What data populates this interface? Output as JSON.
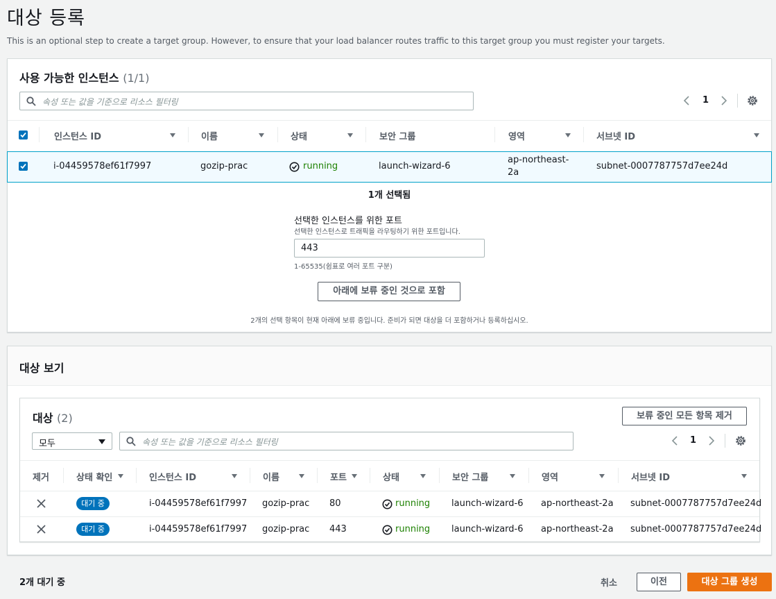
{
  "page": {
    "title": "대상 등록",
    "description": "This is an optional step to create a target group. However, to ensure that your load balancer routes traffic to this target group you must register your targets."
  },
  "available": {
    "title": "사용 가능한 인스턴스",
    "count": "(1/1)",
    "search_placeholder": "속성 또는 값을 기준으로 리소스 필터링",
    "page": "1",
    "columns": [
      "인스턴스 ID",
      "이름",
      "상태",
      "보안 그룹",
      "영역",
      "서브넷 ID"
    ],
    "row": {
      "instance_id": "i-04459578ef61f7997",
      "name": "gozip-prac",
      "state": "running",
      "security_group": "launch-wizard-6",
      "zone_line1": "ap-northeast-",
      "zone_line2": "2a",
      "subnet": "subnet-0007787757d7ee24d"
    },
    "selected_text": "1개 선택됨",
    "port_label": "선택한 인스턴스를 위한 포트",
    "port_desc": "선택한 인스턴스로 트래픽을 라우팅하기 위한 포트입니다.",
    "port_value": "443",
    "port_hint": "1-65535(쉼표로 여러 포트 구분)",
    "include_button": "아래에 보류 중인 것으로 포함",
    "pending_note": "2개의 선택 항목이 현재 아래에 보류 중입니다. 준비가 되면 대상을 더 포함하거나 등록하십시오."
  },
  "review": {
    "title": "대상 보기",
    "targets_title": "대상",
    "targets_count": "(2)",
    "remove_all_button": "보류 중인 모든 항목 제거",
    "filter_select": "모두",
    "search_placeholder": "속성 또는 값을 기준으로 리소스 필터링",
    "page": "1",
    "columns": [
      "제거",
      "상태 확인",
      "인스턴스 ID",
      "이름",
      "포트",
      "상태",
      "보안 그룹",
      "영역",
      "서브넷 ID"
    ],
    "rows": [
      {
        "health": "대기 중",
        "instance_id": "i-04459578ef61f7997",
        "name": "gozip-prac",
        "port": "80",
        "state": "running",
        "security_group": "launch-wizard-6",
        "zone": "ap-northeast-2a",
        "subnet": "subnet-0007787757d7ee24d"
      },
      {
        "health": "대기 중",
        "instance_id": "i-04459578ef61f7997",
        "name": "gozip-prac",
        "port": "443",
        "state": "running",
        "security_group": "launch-wizard-6",
        "zone": "ap-northeast-2a",
        "subnet": "subnet-0007787757d7ee24d"
      }
    ]
  },
  "footer": {
    "pending_count": "2개 대기 중",
    "cancel": "취소",
    "previous": "이전",
    "create": "대상 그룹 생성"
  },
  "colors": {
    "primary": "#ec7211",
    "accent": "#0073bb",
    "success": "#1d8102"
  }
}
